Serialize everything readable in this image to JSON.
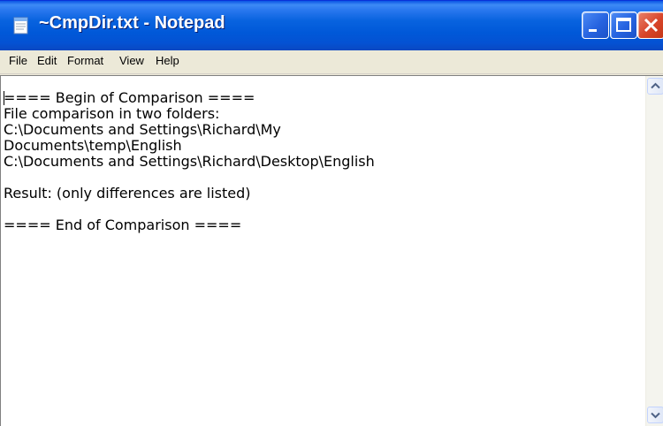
{
  "window": {
    "title": "~CmpDir.txt - Notepad",
    "app_icon": "notepad-icon",
    "controls": [
      "minimize-icon",
      "maximize-icon",
      "close-icon"
    ]
  },
  "menu": {
    "items": [
      "File",
      "Edit",
      "Format",
      "View",
      "Help"
    ]
  },
  "document": {
    "lines": [
      "==== Begin of Comparison ====",
      "File comparison in two folders:",
      "C:\\Documents and Settings\\Richard\\My",
      "Documents\\temp\\English",
      "C:\\Documents and Settings\\Richard\\Desktop\\English",
      "",
      "Result: (only differences are listed)",
      "",
      "==== End of Comparison ===="
    ]
  },
  "scrollbar": {
    "up_icon": "arrow-up-icon",
    "down_icon": "arrow-down-icon"
  },
  "colors": {
    "titlebar": "#0058d8",
    "close_button": "#d8452a",
    "menubar": "#ece9d8",
    "editor_background": "#ffffff"
  }
}
